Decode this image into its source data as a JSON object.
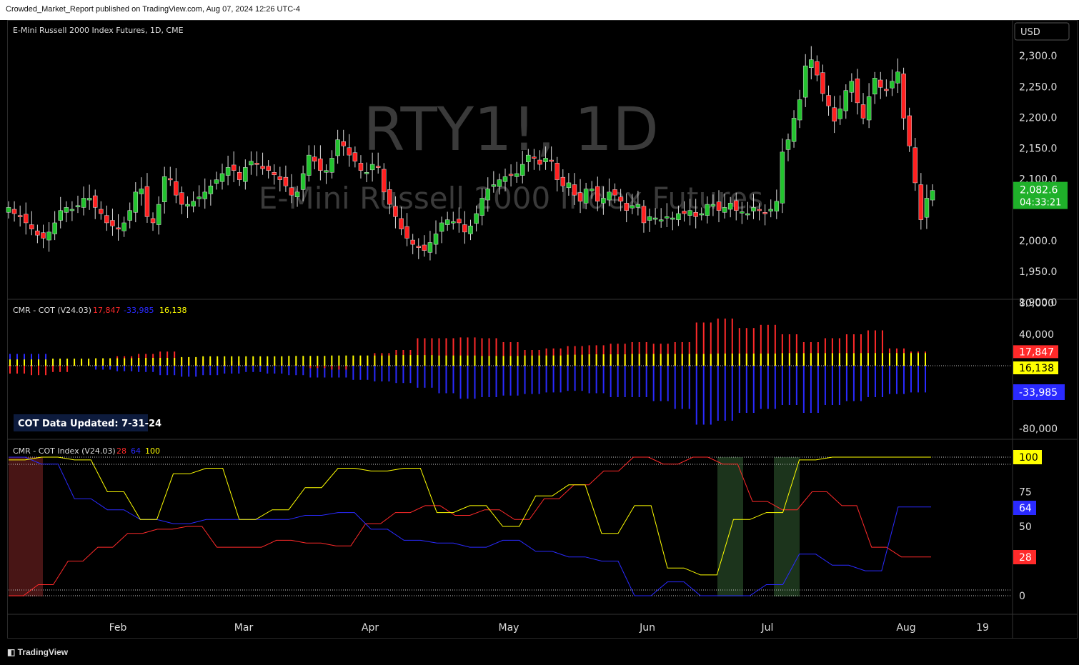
{
  "header": {
    "published_by": "Crowded_Market_Report published on TradingView.com, Aug 07, 2024 12:26 UTC-4"
  },
  "footer": {
    "brand": "TradingView",
    "brand_icon": "tradingview-logo-icon"
  },
  "colors": {
    "up": "#22c32e",
    "down": "#ff2020",
    "commercials": "#ff2a2a",
    "large_spec": "#2a2aff",
    "small_spec": "#ffff00",
    "bg": "#000000"
  },
  "chart_data": [
    {
      "type": "candlestick",
      "title": "E-Mini Russell 2000 Index Futures, 1D, CME",
      "watermark": "RTY1!, 1D",
      "watermark_sub": "E-Mini Russell 2000 Index Futures",
      "currency": "USD",
      "ylim": [
        1900,
        2320
      ],
      "yticks": [
        "2,300.0",
        "2,250.0",
        "2,200.0",
        "2,150.0",
        "2,100.0",
        "2,000.0",
        "1,950.0",
        "1,900.0"
      ],
      "last_price": "2,082.6",
      "countdown": "04:33:21",
      "closes": [
        2055,
        2045,
        2040,
        2030,
        2020,
        2010,
        2005,
        2015,
        2030,
        2050,
        2055,
        2052,
        2058,
        2070,
        2070,
        2055,
        2045,
        2030,
        2025,
        2020,
        2030,
        2050,
        2080,
        2085,
        2040,
        2030,
        2060,
        2105,
        2100,
        2075,
        2060,
        2060,
        2065,
        2072,
        2080,
        2090,
        2100,
        2110,
        2120,
        2115,
        2100,
        2120,
        2130,
        2125,
        2118,
        2115,
        2108,
        2100,
        2090,
        2075,
        2080,
        2110,
        2140,
        2130,
        2115,
        2115,
        2135,
        2165,
        2155,
        2140,
        2130,
        2115,
        2112,
        2125,
        2120,
        2080,
        2060,
        2040,
        2020,
        2005,
        1995,
        1990,
        1985,
        1998,
        2012,
        2030,
        2035,
        2032,
        2030,
        2015,
        2025,
        2045,
        2070,
        2085,
        2092,
        2100,
        2105,
        2108,
        2110,
        2125,
        2140,
        2135,
        2125,
        2135,
        2130,
        2100,
        2090,
        2095,
        2075,
        2065,
        2085,
        2085,
        2065,
        2070,
        2080,
        2075,
        2065,
        2050,
        2058,
        2060,
        2030,
        2040,
        2038,
        2035,
        2040,
        2038,
        2045,
        2045,
        2050,
        2040,
        2045,
        2060,
        2060,
        2050,
        2055,
        2062,
        2050,
        2048,
        2045,
        2055,
        2050,
        2045,
        2052,
        2065,
        2145,
        2165,
        2200,
        2230,
        2285,
        2295,
        2270,
        2240,
        2220,
        2195,
        2215,
        2245,
        2260,
        2225,
        2200,
        2235,
        2265,
        2250,
        2245,
        2260,
        2275,
        2200,
        2155,
        2095,
        2035,
        2070,
        2082.6
      ],
      "annotations": []
    },
    {
      "type": "histogram",
      "title": "CMR - COT (V24.03)",
      "header_values": [
        "17,847",
        "-33,985",
        "16,138"
      ],
      "ylim": [
        -80000,
        80000
      ],
      "yticks": [
        "80,000",
        "40,000",
        "-80,000"
      ],
      "last_commercials": "17,847",
      "last_small": "16,138",
      "last_large": "-33,985",
      "update_note": "COT Data Updated:  7-31-24",
      "weeks": 30,
      "commercials": [
        -10000,
        -12000,
        -8000,
        5000,
        8000,
        12000,
        15000,
        18000,
        10000,
        8000,
        6000,
        4000,
        3000,
        2000,
        -3000,
        -5000,
        8000,
        16000,
        20000,
        35000,
        35000,
        36000,
        35000,
        30000,
        20000,
        22000,
        25000,
        26000,
        28000,
        30000,
        28000,
        30000,
        55000,
        60000,
        48000,
        52000,
        40000,
        30000,
        35000,
        40000,
        45000,
        22000,
        18000
      ],
      "large_spec": [
        15000,
        8000,
        4000,
        -5000,
        -7000,
        -8000,
        -12000,
        -14000,
        -12000,
        -10000,
        -8000,
        -10000,
        -12000,
        -15000,
        -18000,
        -20000,
        -22000,
        -28000,
        -35000,
        -42000,
        -40000,
        -38000,
        -36000,
        -34000,
        -32000,
        -35000,
        -40000,
        -45000,
        -55000,
        -75000,
        -70000,
        -60000,
        -55000,
        -50000,
        -60000,
        -50000,
        -45000,
        -40000,
        -36000,
        -34000
      ],
      "small_spec": [
        8000,
        9000,
        9500,
        10000,
        11000,
        12000,
        12000,
        12500,
        13000,
        13000,
        13500,
        13000,
        12500,
        13000,
        14000,
        14500,
        15000,
        15000,
        15500,
        15500,
        16000,
        16000,
        16100,
        16138
      ]
    },
    {
      "type": "line",
      "title": "CMR - COT Index (V24.03)",
      "header_values": [
        "28",
        "64",
        "100"
      ],
      "ylim": [
        0,
        100
      ],
      "yticks": [
        "75",
        "50",
        "0"
      ],
      "last_commercials": "28",
      "last_large": "64",
      "last_small": "100",
      "series": [
        {
          "values": [
            0,
            0,
            8,
            8,
            25,
            25,
            35,
            35,
            45,
            45,
            48,
            48,
            50,
            50,
            35,
            35,
            35,
            35,
            40,
            40,
            38,
            38,
            36,
            36,
            52,
            52,
            60,
            60,
            65,
            65,
            58,
            58,
            62,
            62,
            55,
            55,
            70,
            70,
            80,
            80,
            90,
            90,
            100,
            100,
            95,
            95,
            100,
            100,
            95,
            95,
            68,
            68,
            62,
            62,
            75,
            75,
            65,
            65,
            35,
            35,
            28,
            28,
            28
          ]
        },
        {
          "values": [
            100,
            100,
            95,
            95,
            70,
            70,
            62,
            62,
            55,
            55,
            52,
            52,
            55,
            55,
            55,
            55,
            55,
            55,
            58,
            58,
            60,
            60,
            48,
            48,
            40,
            40,
            38,
            38,
            35,
            35,
            40,
            40,
            32,
            32,
            28,
            28,
            25,
            25,
            0,
            0,
            10,
            10,
            0,
            0,
            0,
            0,
            8,
            8,
            30,
            30,
            22,
            22,
            18,
            18,
            64,
            64,
            64
          ]
        },
        {
          "values": [
            98,
            98,
            100,
            100,
            98,
            98,
            75,
            75,
            55,
            55,
            88,
            88,
            92,
            92,
            55,
            55,
            62,
            62,
            78,
            78,
            92,
            92,
            90,
            90,
            92,
            92,
            60,
            60,
            65,
            65,
            50,
            50,
            72,
            72,
            80,
            80,
            45,
            45,
            65,
            65,
            20,
            20,
            15,
            15,
            55,
            55,
            60,
            60,
            98,
            98,
            100,
            100,
            100,
            100,
            100,
            100,
            100
          ]
        }
      ],
      "shaded": [
        {
          "color": "#5a1a1a"
        },
        {
          "color": "#1f3a1f"
        },
        {
          "color": "#1f3a1f"
        }
      ]
    }
  ],
  "xaxis": {
    "ticks": [
      "Feb",
      "Mar",
      "Apr",
      "May",
      "Jun",
      "Jul",
      "Aug",
      "19"
    ]
  }
}
